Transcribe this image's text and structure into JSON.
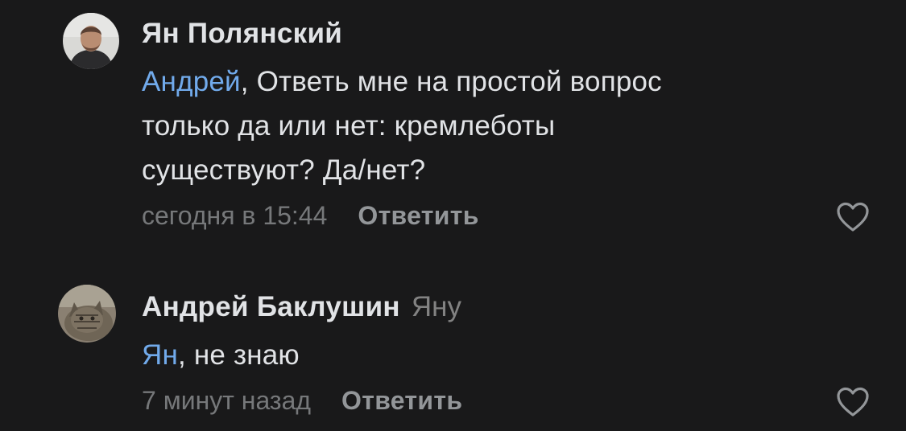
{
  "comments": [
    {
      "author": "Ян Полянский",
      "reply_to": "",
      "mention": "Андрей",
      "text_line1_rest": ", Ответь мне на простой вопрос",
      "text_line2": "только да или нет: кремлеботы",
      "text_line3": "существуют? Да/нет?",
      "time": "сегодня в 15:44",
      "reply_label": "Ответить",
      "avatar_icon": "man-photo-avatar",
      "like_icon": "heart-outline-icon"
    },
    {
      "author": "Андрей Баклушин",
      "reply_to": "Яну",
      "mention": "Ян",
      "text_line1_rest": ", не знаю",
      "time": "7 минут назад",
      "reply_label": "Ответить",
      "avatar_icon": "cat-photo-avatar",
      "like_icon": "heart-outline-icon"
    }
  ],
  "colors": {
    "background": "#19191a",
    "text": "#e1e3e6",
    "mention": "#71aaeb",
    "secondary": "#76787a",
    "reply_button": "#939699"
  }
}
